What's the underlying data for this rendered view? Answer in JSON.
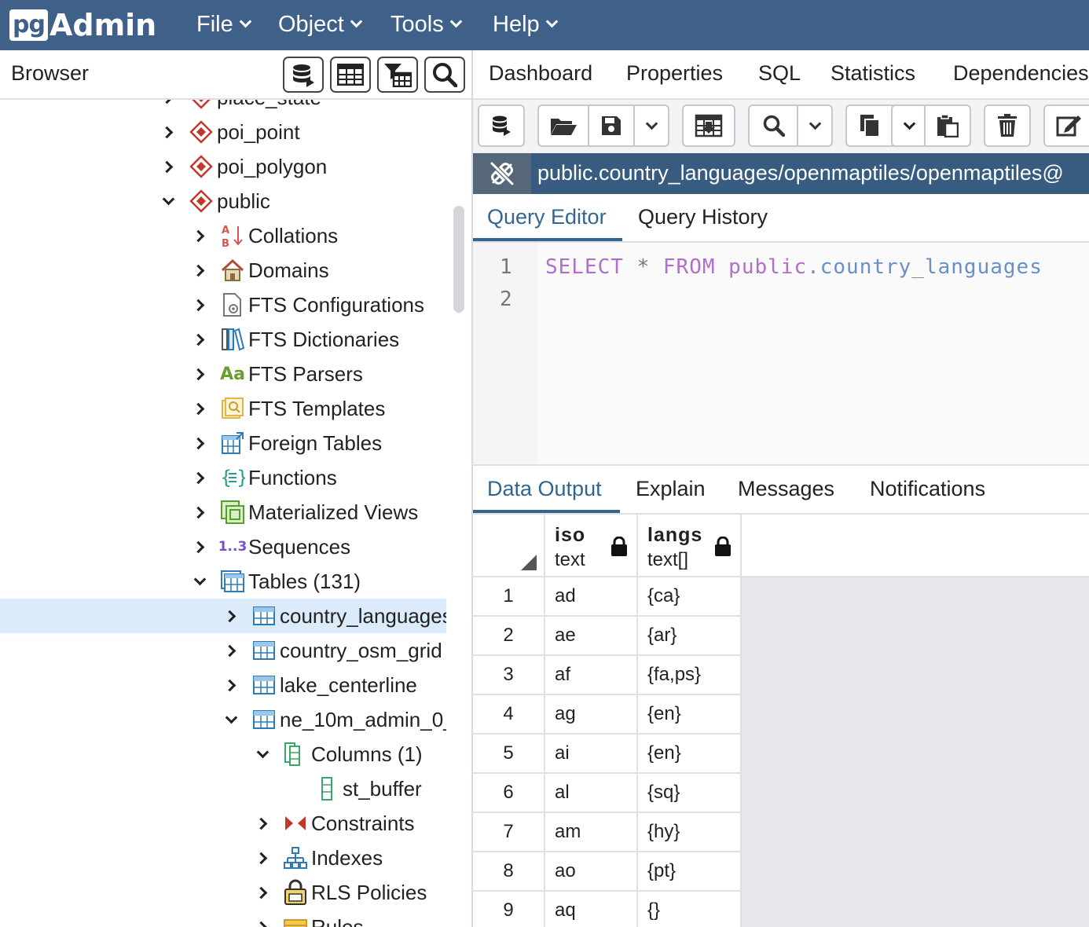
{
  "app": {
    "logo_pg": "pg",
    "logo_admin": "Admin"
  },
  "menu": [
    {
      "label": "File"
    },
    {
      "label": "Object"
    },
    {
      "label": "Tools"
    },
    {
      "label": "Help"
    }
  ],
  "browser": {
    "title": "Browser",
    "toolbar_icons": [
      "query-tool-icon",
      "view-data-icon",
      "filtered-rows-icon",
      "search-objects-icon"
    ],
    "tree": [
      {
        "label": "place_state",
        "icon": "schema-icon",
        "toggle": "collapsed",
        "level": 0
      },
      {
        "label": "poi_point",
        "icon": "schema-icon",
        "toggle": "collapsed",
        "level": 0
      },
      {
        "label": "poi_polygon",
        "icon": "schema-icon",
        "toggle": "collapsed",
        "level": 0
      },
      {
        "label": "public",
        "icon": "schema-icon",
        "toggle": "expanded",
        "level": 0
      },
      {
        "label": "Collations",
        "icon": "collation-icon",
        "toggle": "collapsed",
        "level": 1
      },
      {
        "label": "Domains",
        "icon": "domain-icon",
        "toggle": "collapsed",
        "level": 1
      },
      {
        "label": "FTS Configurations",
        "icon": "fts-configuration-icon",
        "toggle": "collapsed",
        "level": 1
      },
      {
        "label": "FTS Dictionaries",
        "icon": "fts-dictionary-icon",
        "toggle": "collapsed",
        "level": 1
      },
      {
        "label": "FTS Parsers",
        "icon": "fts-parser-icon",
        "icon_text": "Aa",
        "toggle": "collapsed",
        "level": 1
      },
      {
        "label": "FTS Templates",
        "icon": "fts-template-icon",
        "toggle": "collapsed",
        "level": 1
      },
      {
        "label": "Foreign Tables",
        "icon": "foreign-table-icon",
        "toggle": "collapsed",
        "level": 1
      },
      {
        "label": "Functions",
        "icon": "function-icon",
        "toggle": "collapsed",
        "level": 1
      },
      {
        "label": "Materialized Views",
        "icon": "materialized-view-icon",
        "toggle": "collapsed",
        "level": 1
      },
      {
        "label": "Sequences",
        "icon": "sequence-icon",
        "icon_text": "1..3",
        "toggle": "collapsed",
        "level": 1
      },
      {
        "label": "Tables (131)",
        "icon": "tables-icon",
        "toggle": "expanded",
        "level": 1
      },
      {
        "label": "country_languages",
        "icon": "table-icon",
        "toggle": "collapsed",
        "level": 2,
        "selected": true
      },
      {
        "label": "country_osm_grid",
        "icon": "table-icon",
        "toggle": "collapsed",
        "level": 2
      },
      {
        "label": "lake_centerline",
        "icon": "table-icon",
        "toggle": "collapsed",
        "level": 2
      },
      {
        "label": "ne_10m_admin_0_",
        "icon": "table-icon",
        "toggle": "expanded",
        "level": 2
      },
      {
        "label": "Columns (1)",
        "icon": "columns-icon",
        "toggle": "expanded",
        "level": 3
      },
      {
        "label": "st_buffer",
        "icon": "column-icon",
        "toggle": "none",
        "level": 4
      },
      {
        "label": "Constraints",
        "icon": "constraints-icon",
        "toggle": "collapsed",
        "level": 3
      },
      {
        "label": "Indexes",
        "icon": "indexes-icon",
        "toggle": "collapsed",
        "level": 3
      },
      {
        "label": "RLS Policies",
        "icon": "rls-policy-icon",
        "toggle": "collapsed",
        "level": 3
      },
      {
        "label": "Rules",
        "icon": "rules-icon",
        "toggle": "collapsed",
        "level": 3
      }
    ]
  },
  "main_tabs": [
    {
      "label": "Dashboard"
    },
    {
      "label": "Properties"
    },
    {
      "label": "SQL"
    },
    {
      "label": "Statistics"
    },
    {
      "label": "Dependencies"
    }
  ],
  "query_tool": {
    "toolbar_icons": [
      "database-icon",
      "open-file-icon",
      "save-icon",
      "chevron-down-icon",
      "save-data-icon",
      "find-icon",
      "chevron-down-icon",
      "copy-icon",
      "chevron-down-icon",
      "paste-icon",
      "delete-icon",
      "edit-icon"
    ],
    "connection": "public.country_languages/openmaptiles/openmaptiles@",
    "editor_tabs": [
      {
        "label": "Query Editor",
        "active": true
      },
      {
        "label": "Query History",
        "active": false
      }
    ],
    "line_numbers": [
      "1",
      "2"
    ],
    "sql": {
      "select": "SELECT",
      "star": "*",
      "from": "FROM",
      "schema": "public",
      "dot": ".",
      "table": "country_languages"
    },
    "output_tabs": [
      {
        "label": "Data Output",
        "active": true
      },
      {
        "label": "Explain",
        "active": false
      },
      {
        "label": "Messages",
        "active": false
      },
      {
        "label": "Notifications",
        "active": false
      }
    ],
    "columns": [
      {
        "name": "iso",
        "type": "text"
      },
      {
        "name": "langs",
        "type": "text[]"
      }
    ],
    "rows": [
      [
        "1",
        "ad",
        "{ca}"
      ],
      [
        "2",
        "ae",
        "{ar}"
      ],
      [
        "3",
        "af",
        "{fa,ps}"
      ],
      [
        "4",
        "ag",
        "{en}"
      ],
      [
        "5",
        "ai",
        "{en}"
      ],
      [
        "6",
        "al",
        "{sq}"
      ],
      [
        "7",
        "am",
        "{hy}"
      ],
      [
        "8",
        "ao",
        "{pt}"
      ],
      [
        "9",
        "aq",
        "{}"
      ]
    ]
  },
  "colors": {
    "nav": "#3f6189",
    "accent": "#326690",
    "selected_row": "#dcebf9",
    "schema_icon": "#c0392b",
    "keyword": "#b26fc9"
  }
}
